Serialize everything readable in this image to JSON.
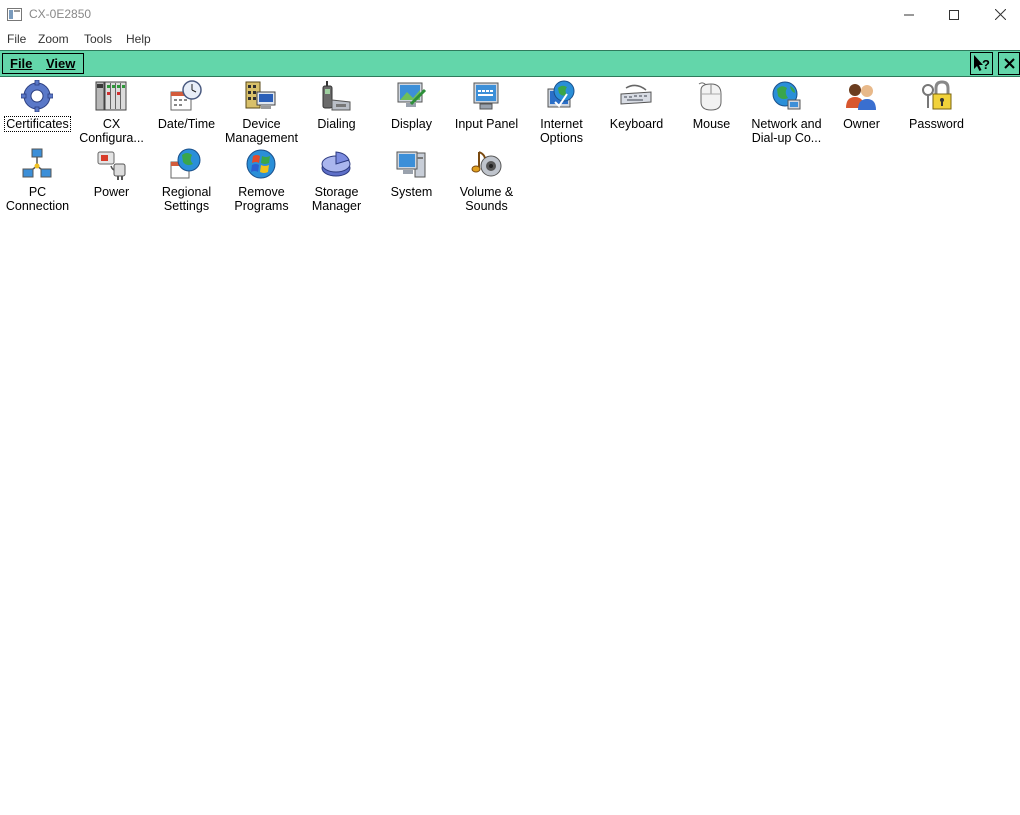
{
  "window": {
    "title": "CX-0E2850",
    "minimize_icon": "minimize-icon",
    "maximize_icon": "maximize-icon",
    "close_icon": "close-icon"
  },
  "host_menu": {
    "items": [
      "File",
      "Zoom",
      "Tools",
      "Help"
    ]
  },
  "device_bar": {
    "menu_items": [
      "File",
      "View"
    ],
    "help_icon": "help-pointer-icon",
    "close_icon": "close-icon",
    "color": "#63d6aa"
  },
  "control_panel": {
    "items": [
      {
        "label": "Certificates",
        "icon": "gear-icon"
      },
      {
        "label": "CX\nConfigura...",
        "icon": "cx-module-icon"
      },
      {
        "label": "Date/Time",
        "icon": "calendar-clock-icon"
      },
      {
        "label": "Device\nManagement",
        "icon": "device-management-icon"
      },
      {
        "label": "Dialing",
        "icon": "phone-icon"
      },
      {
        "label": "Display",
        "icon": "display-icon"
      },
      {
        "label": "Input Panel",
        "icon": "input-panel-icon"
      },
      {
        "label": "Internet\nOptions",
        "icon": "globe-monitor-icon"
      },
      {
        "label": "Keyboard",
        "icon": "keyboard-icon"
      },
      {
        "label": "Mouse",
        "icon": "mouse-icon"
      },
      {
        "label": "Network and\nDial-up Co...",
        "icon": "network-globe-icon"
      },
      {
        "label": "Owner",
        "icon": "users-icon"
      },
      {
        "label": "Password",
        "icon": "lock-keys-icon"
      },
      {
        "label": "PC\nConnection",
        "icon": "pc-connection-icon"
      },
      {
        "label": "Power",
        "icon": "power-plug-icon"
      },
      {
        "label": "Regional\nSettings",
        "icon": "regional-globe-icon"
      },
      {
        "label": "Remove\nPrograms",
        "icon": "windows-logo-icon"
      },
      {
        "label": "Storage\nManager",
        "icon": "pie-disk-icon"
      },
      {
        "label": "System",
        "icon": "computer-icon"
      },
      {
        "label": "Volume &\nSounds",
        "icon": "speaker-note-icon"
      }
    ],
    "selected_index": 0
  }
}
